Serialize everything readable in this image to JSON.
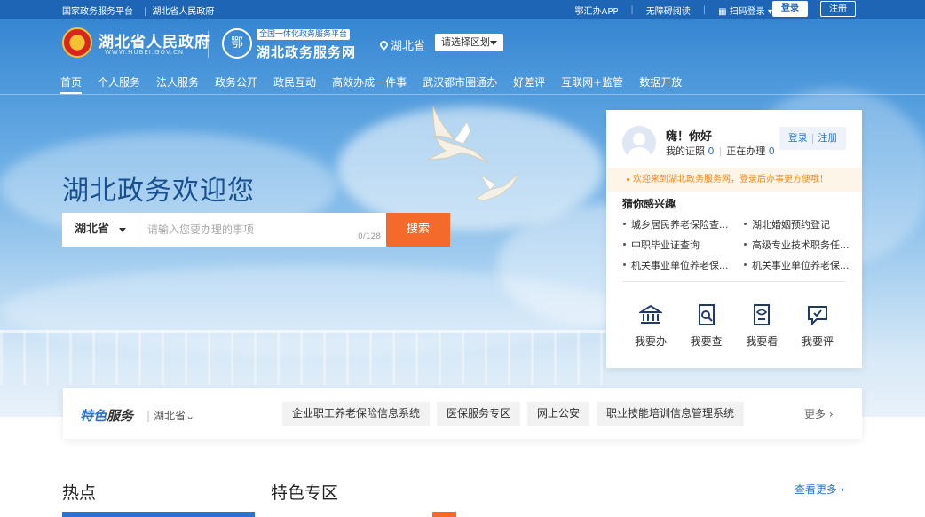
{
  "topbar": {
    "left_links": [
      "国家政务服务平台",
      "湖北省人民政府"
    ],
    "right_links": [
      "鄂汇办APP",
      "无障碍阅读",
      "扫码登录"
    ],
    "login": "登录",
    "register": "注册"
  },
  "header": {
    "gov_title": "湖北省人民政府",
    "gov_sub": "WWW.HUBEI.GOV.CN",
    "platform_tag": "全国一体化政务服务平台",
    "platform_title": "湖北政务服务网",
    "location": "湖北省",
    "region_select": "请选择区划"
  },
  "nav": [
    "首页",
    "个人服务",
    "法人服务",
    "政务公开",
    "政民互动",
    "高效办成一件事",
    "武汉都市圈通办",
    "好差评",
    "互联网+监管",
    "数据开放"
  ],
  "hero": {
    "welcome": "湖北政务欢迎您",
    "search_area": "湖北省",
    "search_placeholder": "请输入您要办理的事项",
    "search_count": "0/128",
    "search_button": "搜索"
  },
  "panel": {
    "greeting": "嗨！你好",
    "my_cert_label": "我的证照",
    "my_cert_count": "0",
    "in_progress_label": "正在办理",
    "in_progress_count": "0",
    "login": "登录",
    "register": "注册",
    "notice": "欢迎来到湖北政务服务网，登录后办事更方便哦！",
    "guess_title": "猜你感兴趣",
    "guess_items": [
      "城乡居民养老保险查...",
      "湖北婚姻预约登记",
      "中职毕业证查询",
      "高级专业技术职务任...",
      "机关事业单位养老保...",
      "机关事业单位养老保..."
    ],
    "actions": [
      {
        "label": "我要办",
        "icon": "bank-icon"
      },
      {
        "label": "我要查",
        "icon": "search-doc-icon"
      },
      {
        "label": "我要看",
        "icon": "view-doc-icon"
      },
      {
        "label": "我要评",
        "icon": "comment-check-icon"
      }
    ]
  },
  "featured": {
    "title_a": "特色",
    "title_b": "服务",
    "province": "湖北省",
    "tags": [
      "企业职工养老保险信息系统",
      "医保服务专区",
      "网上公安",
      "职业技能培训信息管理系统"
    ],
    "more": "更多"
  },
  "sections": {
    "hot": "热点",
    "special": "特色专区",
    "see_more": "查看更多"
  },
  "colors": {
    "brand_blue": "#1e66b5",
    "accent_orange": "#f46a2a",
    "link_blue": "#2d72c8"
  }
}
